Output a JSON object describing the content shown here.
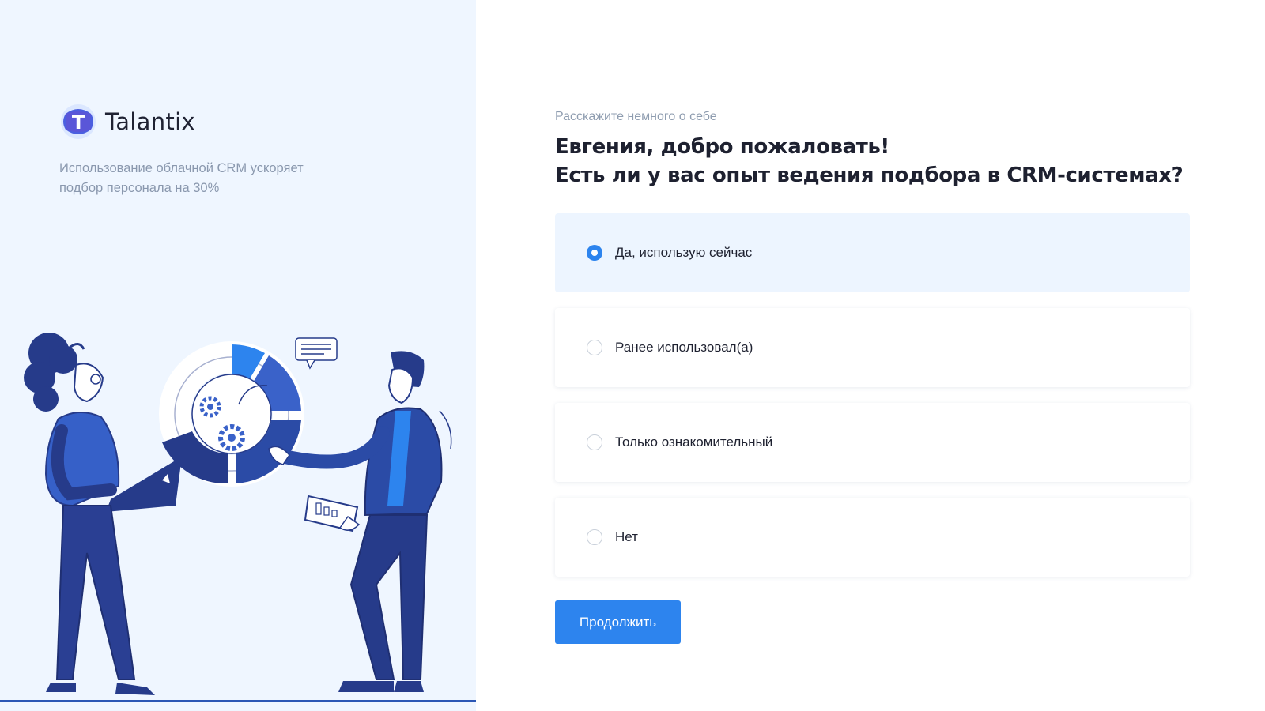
{
  "progress": {
    "fraction": 0.125
  },
  "brand": {
    "name": "Talantix",
    "logo_letter": "T",
    "logo_icon": "talantix-logo-icon"
  },
  "tagline": "Использование облачной CRM ускоряет подбор персонала на 30%",
  "illustration": {
    "icon": "team-crm-illustration"
  },
  "form": {
    "subtitle": "Расскажите немного о себе",
    "title_line1": "Евгения, добро пожаловать!",
    "title_line2": "Есть ли у вас опыт ведения подбора в CRM-системах?",
    "options": [
      {
        "label": "Да, использую сейчас",
        "selected": true
      },
      {
        "label": "Ранее использовал(а)",
        "selected": false
      },
      {
        "label": "Только ознакомительный",
        "selected": false
      },
      {
        "label": "Нет",
        "selected": false
      }
    ],
    "continue_label": "Продолжить"
  },
  "colors": {
    "accent": "#2d84ee",
    "left_panel_bg": "#eff6ff",
    "selected_option_bg": "#edf5ff",
    "illustration_dark": "#2b3f8f",
    "illustration_mid": "#3a62c9"
  }
}
